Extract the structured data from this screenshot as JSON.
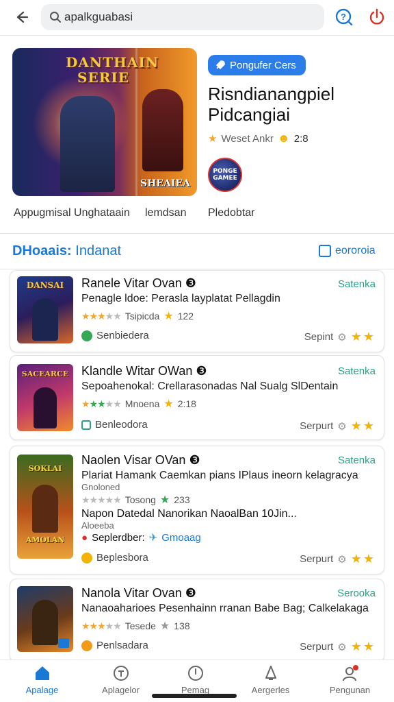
{
  "topbar": {
    "search_value": "apalkguabasi"
  },
  "featured": {
    "badge": "Pongufer Cers",
    "image_title": "DANTHAIN SERIE",
    "image_corner": "SHEAIEA",
    "title": "Risndianangpiel Pidcangiai",
    "meta_text": "Weset Ankr",
    "meta_num": "2:8",
    "avatar_text": "PONGE GAMEE",
    "links": [
      "Appugmisal Unghataain",
      "lemdsan",
      "Pledobtar"
    ]
  },
  "section": {
    "title_bold": "DHoaais:",
    "title_rest": "Indanat",
    "check_label": "eororoia"
  },
  "cards": [
    {
      "name": "Ranele Vitar Ovan",
      "tag": "Satenka",
      "desc": "Penagle ldoe: Perasla layplatat Pellagdin",
      "rating_text": "Tsipicda",
      "rating_num": "122",
      "dev": "Senbiedera",
      "support": "Sepint"
    },
    {
      "name": "Klandle Witar OWan",
      "tag": "Satenka",
      "desc": "Sepoahenokal: Crellarasonadas Nal Sualg SlDentain",
      "rating_text": "Mnoena",
      "rating_num": "2:18",
      "dev": "Benleodora",
      "support": "Serpurt"
    },
    {
      "name": "Naolen Visar OVan",
      "tag": "Satenka",
      "desc": "Plariat Hamank Caemkan pians IPlaus ineorn kelagracya",
      "desc2": "Gnoloned",
      "rating_text": "Tosong",
      "rating_num": "233",
      "extra1": "Napon Datedal Nanorikan NaoalBan 10Jin...",
      "extra2": "Aloeeba",
      "extra3_label": "Seplerdber:",
      "extra3_link": "Gmoaag",
      "dev": "Beplesbora",
      "support": "Serpurt"
    },
    {
      "name": "Nanola Vitar Ovan",
      "tag": "Serooka",
      "desc": "Nanaoaharioes Pesenhainn rranan Babe Bag; Calkelakaga",
      "rating_text": "Tesede",
      "rating_num": "138",
      "dev": "Penlsadara",
      "support": "Serpurt"
    }
  ],
  "nav": [
    {
      "label": "Apalage",
      "icon": "home-icon"
    },
    {
      "label": "Aplagelor",
      "icon": "games-icon"
    },
    {
      "label": "Pemag",
      "icon": "clock-icon"
    },
    {
      "label": "Aergerles",
      "icon": "bell-icon"
    },
    {
      "label": "Pengunan",
      "icon": "profile-icon"
    }
  ],
  "colors": {
    "accent": "#1a78d6",
    "badge": "#2b7de9",
    "tag": "#2aa089",
    "star": "#f2a531"
  }
}
